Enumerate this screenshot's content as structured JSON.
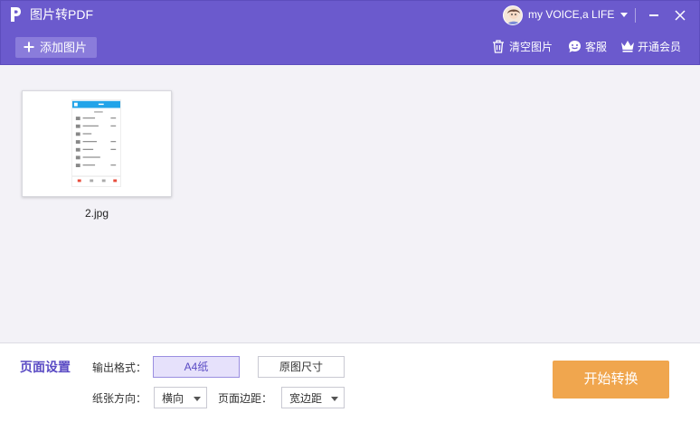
{
  "app": {
    "title": "图片转PDF"
  },
  "user": {
    "name": "my VOICE,a LIFE"
  },
  "toolbar": {
    "add_label": "添加图片",
    "clear_label": "清空图片",
    "service_label": "客服",
    "vip_label": "开通会员"
  },
  "files": [
    {
      "name": "2.jpg"
    }
  ],
  "settings": {
    "title": "页面设置",
    "format_label": "输出格式：",
    "format_options": [
      "A4纸",
      "原图尺寸"
    ],
    "format_selected": "A4纸",
    "orientation_label": "纸张方向：",
    "orientation_value": "横向",
    "margin_label": "页面边距：",
    "margin_value": "宽边距"
  },
  "actions": {
    "convert_label": "开始转换"
  },
  "colors": {
    "header": "#6b5acd",
    "accent": "#5a4bc4",
    "convert": "#f0a64e"
  },
  "icons": {
    "logo": "p-logo-icon",
    "add": "plus-icon",
    "clear": "trash-icon",
    "service": "chat-smile-icon",
    "vip": "crown-icon",
    "minimize": "minimize-icon",
    "close": "close-icon"
  }
}
